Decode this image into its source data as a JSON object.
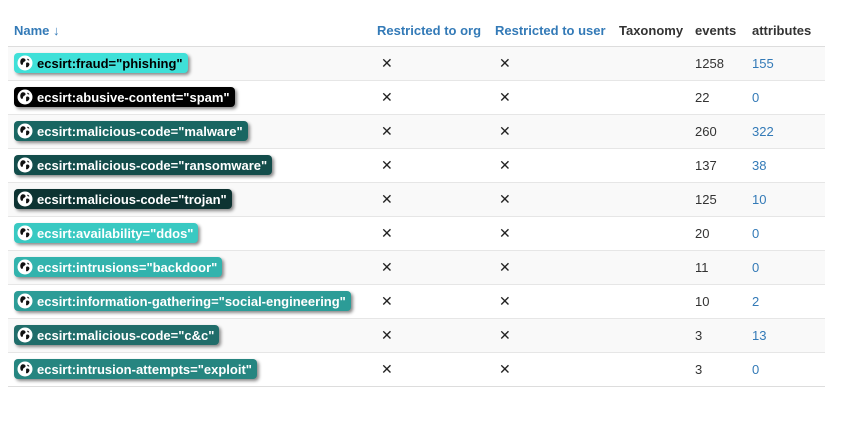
{
  "header": {
    "name": "Name ↓",
    "restricted_org": "Restricted to org",
    "restricted_user": "Restricted to user",
    "taxonomy": "Taxonomy",
    "events": "events",
    "attributes": "attributes"
  },
  "cross_glyph": "✕",
  "icons": {
    "tag_icon": "globe-icon",
    "cross_icon": "close-icon"
  },
  "rows": [
    {
      "tag": "ecsirt:fraud=\"phishing\"",
      "color": "#3fe0d8",
      "text_color": "#000000",
      "events": "1258",
      "attributes": "155"
    },
    {
      "tag": "ecsirt:abusive-content=\"spam\"",
      "color": "#000000",
      "text_color": "#ffffff",
      "events": "22",
      "attributes": "0"
    },
    {
      "tag": "ecsirt:malicious-code=\"malware\"",
      "color": "#196662",
      "text_color": "#ffffff",
      "events": "260",
      "attributes": "322"
    },
    {
      "tag": "ecsirt:malicious-code=\"ransomware\"",
      "color": "#134d4b",
      "text_color": "#ffffff",
      "events": "137",
      "attributes": "38"
    },
    {
      "tag": "ecsirt:malicious-code=\"trojan\"",
      "color": "#0d3332",
      "text_color": "#ffffff",
      "events": "125",
      "attributes": "10"
    },
    {
      "tag": "ecsirt:availability=\"ddos\"",
      "color": "#39c9c2",
      "text_color": "#ffffff",
      "events": "20",
      "attributes": "0"
    },
    {
      "tag": "ecsirt:intrusions=\"backdoor\"",
      "color": "#32b3ad",
      "text_color": "#ffffff",
      "events": "11",
      "attributes": "0"
    },
    {
      "tag": "ecsirt:information-gathering=\"social-engineering\"",
      "color": "#2c9c97",
      "text_color": "#ffffff",
      "events": "10",
      "attributes": "2"
    },
    {
      "tag": "ecsirt:malicious-code=\"c&c\"",
      "color": "#206d6a",
      "text_color": "#ffffff",
      "events": "3",
      "attributes": "13"
    },
    {
      "tag": "ecsirt:intrusion-attempts=\"exploit\"",
      "color": "#268580",
      "text_color": "#ffffff",
      "events": "3",
      "attributes": "0"
    }
  ]
}
